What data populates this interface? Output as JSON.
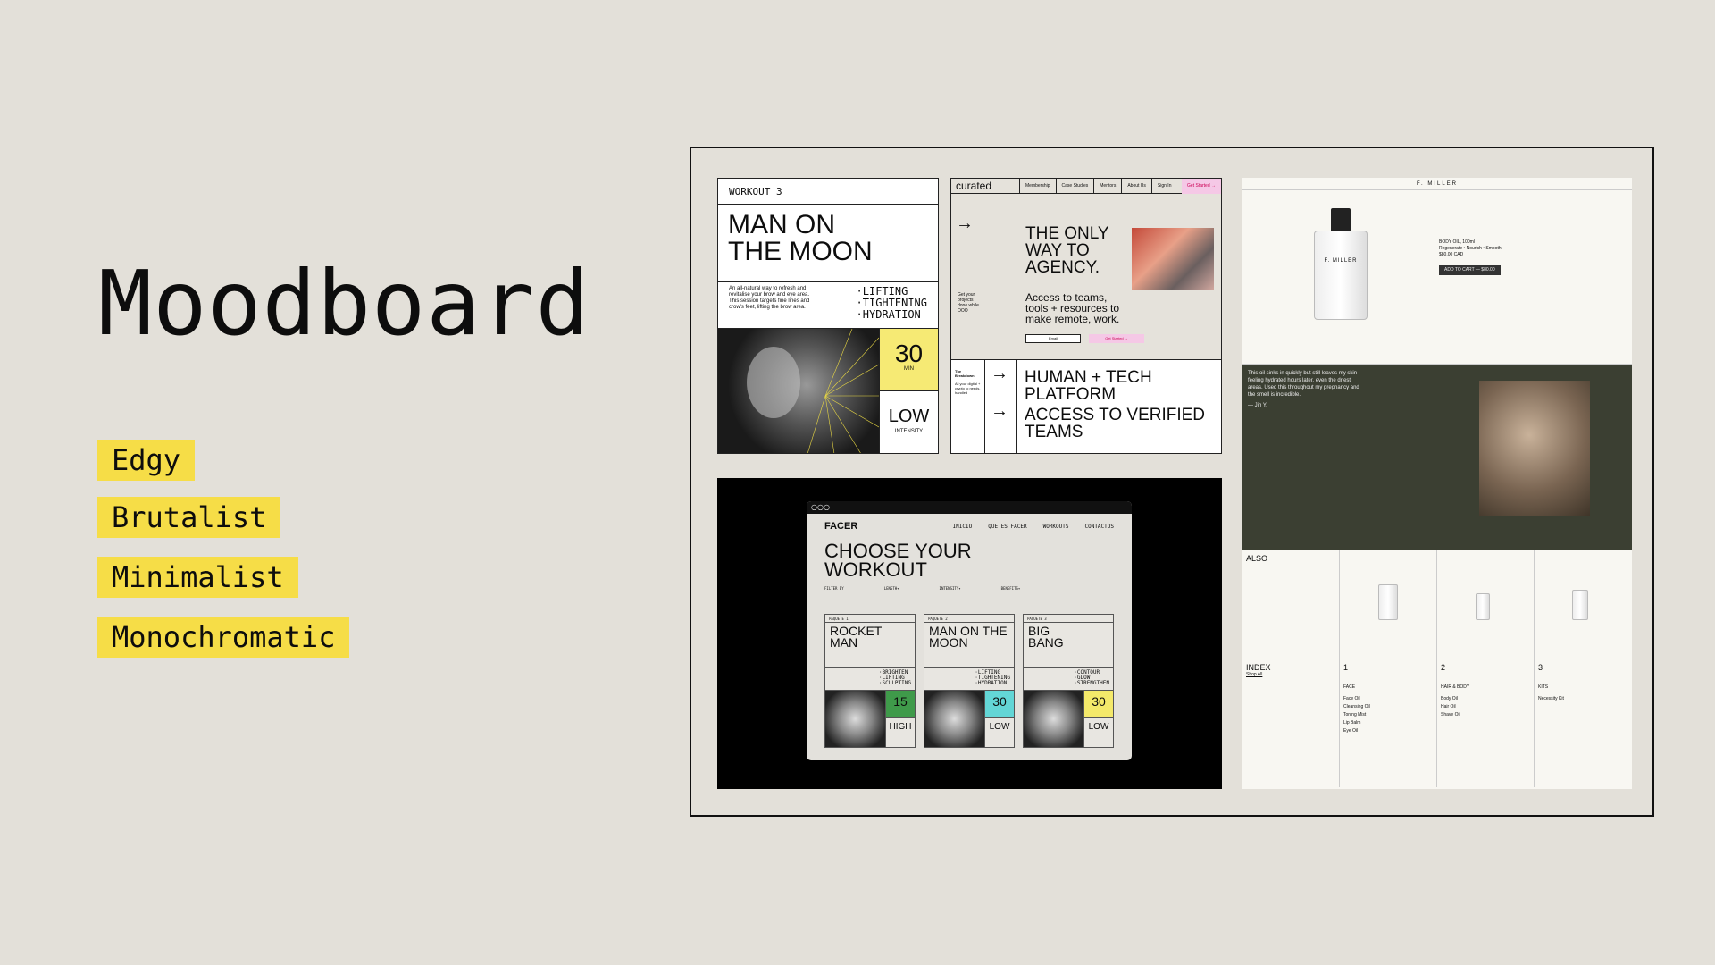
{
  "page": {
    "title": "Moodboard"
  },
  "tags": [
    "Edgy",
    "Brutalist",
    "Minimalist",
    "Monochromatic"
  ],
  "colors": {
    "accent": "#f6dd47",
    "background": "#e3e0d9",
    "ink": "#0d0d0d"
  },
  "workout_card": {
    "header": "WORKOUT 3",
    "title_line1": "MAN ON",
    "title_line2": "THE MOON",
    "description": "An all-natural way to refresh and revitalise your brow and eye area. This session targets fine lines and crow's feet, lifting the brow area.",
    "benefits": [
      "·LIFTING",
      "·TIGHTENING",
      "·HYDRATION"
    ],
    "duration": "30",
    "duration_unit": "MIN",
    "intensity": "LOW",
    "intensity_label": "INTENSITY"
  },
  "agency_card": {
    "logo": "curated",
    "nav": [
      "Membership",
      "Case Studies",
      "Mentors",
      "About Us",
      "Sign In"
    ],
    "cta": "Get Started →",
    "headline_lines": [
      "THE ONLY",
      "WAY TO",
      "AGENCY."
    ],
    "sub_lines": [
      "Access to teams,",
      "tools + resources to",
      "make remote, work."
    ],
    "side_text": "Get your projects done while OOO",
    "input_placeholder": "Email",
    "button": "Get Started →",
    "breakdown_label": "The Breakdown",
    "breakdown_text": "All your digital + crypto to needs, handled",
    "feature1_lines": [
      "HUMAN + TECH",
      "PLATFORM"
    ],
    "feature2_lines": [
      "ACCESS TO VERIFIED",
      "TEAMS"
    ]
  },
  "facer_card": {
    "window_dots": "○○○",
    "logo": "FACER",
    "nav": [
      "INICIO",
      "QUE ES FACER",
      "WORKOUTS",
      "CONTACTOS"
    ],
    "headline_lines": [
      "CHOOSE YOUR",
      "WORKOUT"
    ],
    "filters": [
      "FILTER BY",
      "LENGTH▾",
      "INTENSITY▾",
      "BENEFITS▾"
    ],
    "packages": [
      {
        "label": "PAQUETE 1",
        "title_lines": [
          "ROCKET",
          "MAN"
        ],
        "benefits": [
          "·BRIGHTEN",
          "·LIFTING",
          "·SCULPTING"
        ],
        "duration": "15",
        "intensity": "HIGH",
        "color": "#3f9a4a"
      },
      {
        "label": "PAQUETE 2",
        "title_lines": [
          "MAN ON THE",
          "MOON"
        ],
        "benefits": [
          "·LIFTING",
          "·TIGHTENING",
          "·HYDRATION"
        ],
        "duration": "30",
        "intensity": "LOW",
        "color": "#63d6d6"
      },
      {
        "label": "PAQUETE 3",
        "title_lines": [
          "BIG",
          "BANG"
        ],
        "benefits": [
          "·CONTOUR",
          "·GLOW",
          "·STRENGTHEN"
        ],
        "duration": "30",
        "intensity": "LOW",
        "color": "#f4e96a"
      }
    ]
  },
  "miller_card": {
    "brand": "F. MILLER",
    "bottle_label": "F. MILLER",
    "product_name": "BODY OIL, 100ml",
    "product_desc": "Regenerate • Nourish • Smooth",
    "price": "$80.00 CAD",
    "add_button": "ADD TO CART — $80.00",
    "quote": "This oil sinks in quickly but still leaves my skin feeling hydrated hours later, even the driest areas. Used this throughout my pregnancy and the smell is incredible.",
    "quote_author": "— Jin Y.",
    "also_label": "ALSO",
    "index_label": "INDEX",
    "shop_all": "Shop All",
    "index_cols": [
      {
        "num": "1",
        "title": "FACE",
        "items": [
          "Face Oil",
          "Cleansing Oil",
          "Toning Mist",
          "Lip Balm",
          "Eye Oil"
        ]
      },
      {
        "num": "2",
        "title": "HAIR & BODY",
        "items": [
          "Body Oil",
          "Hair Oil",
          "Shave Oil"
        ]
      },
      {
        "num": "3",
        "title": "KITS",
        "items": [
          "Necessity Kit"
        ]
      }
    ]
  }
}
